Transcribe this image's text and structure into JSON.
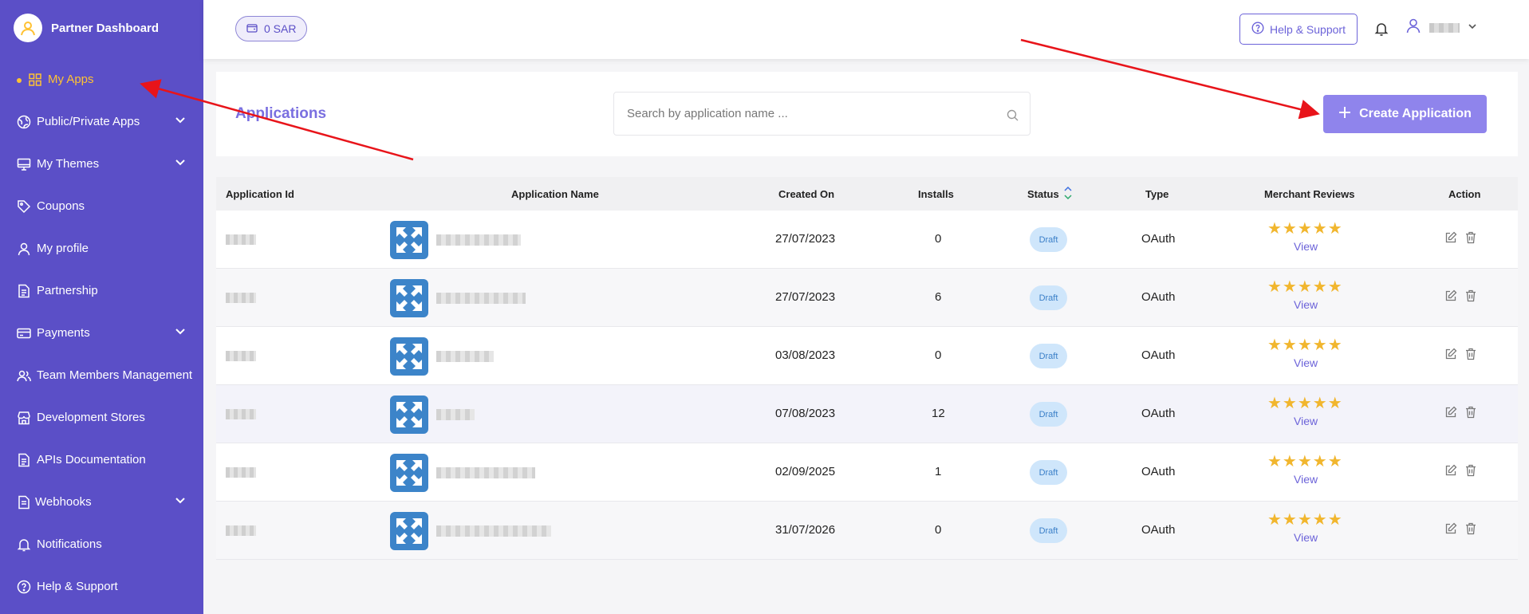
{
  "sidebar": {
    "brand_title": "Partner Dashboard",
    "items": [
      {
        "label": "My Apps",
        "icon": "grid-icon",
        "active": true
      },
      {
        "label": "Public/Private Apps",
        "icon": "globe-icon",
        "expandable": true
      },
      {
        "label": "My Themes",
        "icon": "monitor-icon",
        "expandable": true
      },
      {
        "label": "Coupons",
        "icon": "tag-icon"
      },
      {
        "label": "My profile",
        "icon": "user-icon"
      },
      {
        "label": "Partnership",
        "icon": "document-icon"
      },
      {
        "label": "Payments",
        "icon": "credit-card-icon",
        "expandable": true
      },
      {
        "label": "Team Members Management",
        "icon": "team-icon"
      },
      {
        "label": "Development Stores",
        "icon": "store-icon"
      },
      {
        "label": "APIs Documentation",
        "icon": "document-icon"
      },
      {
        "label": "Webhooks",
        "icon": "webhook-icon",
        "expandable": true
      },
      {
        "label": "Notifications",
        "icon": "bell-icon"
      },
      {
        "label": "Help & Support",
        "icon": "help-icon"
      }
    ]
  },
  "header": {
    "wallet": "0 SAR",
    "help_support": "Help & Support"
  },
  "apps": {
    "title": "Applications",
    "search_placeholder": "Search by application name ...",
    "create_button": "Create Application"
  },
  "table": {
    "columns": [
      "Application Id",
      "Application Name",
      "Created On",
      "Installs",
      "Status",
      "Type",
      "Merchant Reviews",
      "Action"
    ],
    "rows": [
      {
        "created_on": "27/07/2023",
        "installs": "0",
        "status": "Draft",
        "type": "OAuth",
        "stars": "★★★★★",
        "view": "View"
      },
      {
        "created_on": "27/07/2023",
        "installs": "6",
        "status": "Draft",
        "type": "OAuth",
        "stars": "★★★★★",
        "view": "View"
      },
      {
        "created_on": "03/08/2023",
        "installs": "0",
        "status": "Draft",
        "type": "OAuth",
        "stars": "★★★★★",
        "view": "View"
      },
      {
        "created_on": "07/08/2023",
        "installs": "12",
        "status": "Draft",
        "type": "OAuth",
        "stars": "★★★★★",
        "view": "View"
      },
      {
        "created_on": "02/09/2025",
        "installs": "1",
        "status": "Draft",
        "type": "OAuth",
        "stars": "★★★★★",
        "view": "View"
      },
      {
        "created_on": "31/07/2026",
        "installs": "0",
        "status": "Draft",
        "type": "OAuth",
        "stars": "★★★★★",
        "view": "View"
      }
    ]
  },
  "colors": {
    "sidebar_bg": "#5b4fc7",
    "active_accent": "#ffc233",
    "primary": "#8f84ec",
    "annotation_arrow": "#e8141a"
  }
}
